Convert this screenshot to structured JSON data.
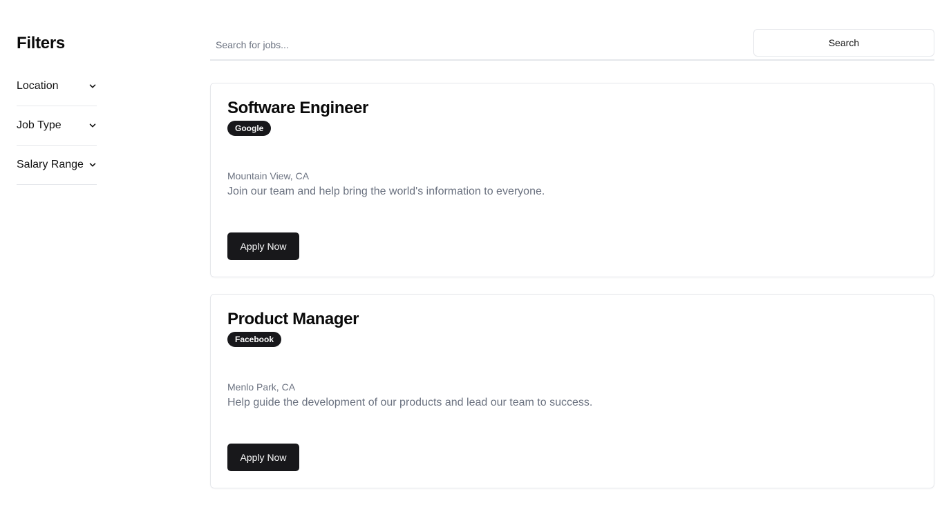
{
  "sidebar": {
    "title": "Filters",
    "filters": [
      {
        "label": "Location",
        "icon": "chevron-down-icon"
      },
      {
        "label": "Job Type",
        "icon": "chevron-down-icon"
      },
      {
        "label": "Salary Range",
        "icon": "chevron-down-icon"
      }
    ]
  },
  "search": {
    "placeholder": "Search for jobs...",
    "value": "",
    "button_label": "Search"
  },
  "jobs": [
    {
      "title": "Software Engineer",
      "company": "Google",
      "location": "Mountain View, CA",
      "description": "Join our team and help bring the world's information to everyone.",
      "apply_label": "Apply Now"
    },
    {
      "title": "Product Manager",
      "company": "Facebook",
      "location": "Menlo Park, CA",
      "description": "Help guide the development of our products and lead our team to success.",
      "apply_label": "Apply Now"
    }
  ],
  "colors": {
    "primary": "#18181b",
    "muted_text": "#6b7280",
    "border": "#e5e7eb",
    "background": "#ffffff"
  }
}
